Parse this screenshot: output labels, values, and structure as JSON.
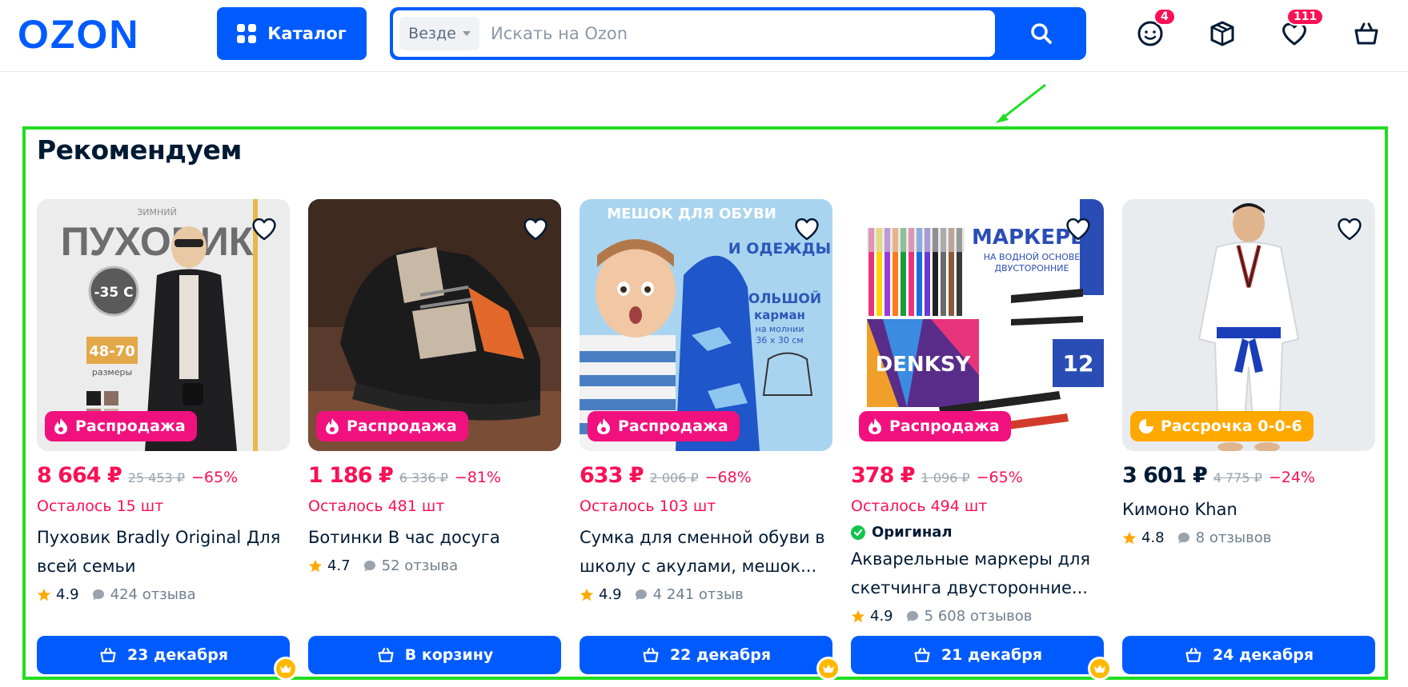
{
  "header": {
    "logo_text": "OZON",
    "catalog_label": "Каталог",
    "search": {
      "scope": "Везде",
      "placeholder": "Искать на Ozon"
    },
    "icons": [
      {
        "name": "profile-icon",
        "badge": "4"
      },
      {
        "name": "orders-icon",
        "badge": ""
      },
      {
        "name": "favorites-icon",
        "badge": "111"
      },
      {
        "name": "cart-icon",
        "badge": ""
      }
    ],
    "colors": {
      "brand": "#005bff",
      "accent": "#f91155"
    }
  },
  "section": {
    "title": "Рекомендуем",
    "products": [
      {
        "image": "winter-coat-photo",
        "badge": "Распродажа",
        "badge_icon": "fire-icon",
        "badge_color": "#f1117e",
        "price": "8 664 ₽",
        "old_price": "25 453 ₽",
        "discount": "−65%",
        "price_color": "#f91155",
        "stock": "Осталось 15 шт",
        "original": "",
        "name": "Пуховик Bradly Original Для всей семьи",
        "rating": "4.9",
        "reviews": "424 отзыва",
        "button": "23 декабря",
        "premium": true
      },
      {
        "image": "sneakers-photo",
        "badge": "Распродажа",
        "badge_icon": "fire-icon",
        "badge_color": "#f1117e",
        "price": "1 186 ₽",
        "old_price": "6 336 ₽",
        "discount": "−81%",
        "price_color": "#f91155",
        "stock": "Осталось 481 шт",
        "original": "",
        "name": "Ботинки В час досуга",
        "rating": "4.7",
        "reviews": "52 отзыва",
        "button": "В корзину",
        "premium": false
      },
      {
        "image": "shoe-bag-photo",
        "badge": "Распродажа",
        "badge_icon": "fire-icon",
        "badge_color": "#f1117e",
        "price": "633 ₽",
        "old_price": "2 006 ₽",
        "discount": "−68%",
        "price_color": "#f91155",
        "stock": "Осталось 103 шт",
        "original": "",
        "name": "Сумка для сменной обуви в школу с акулами, мешок...",
        "rating": "4.9",
        "reviews": "4 241 отзыв",
        "button": "22 декабря",
        "premium": true
      },
      {
        "image": "markers-photo",
        "badge": "Распродажа",
        "badge_icon": "fire-icon",
        "badge_color": "#f1117e",
        "price": "378 ₽",
        "old_price": "1 096 ₽",
        "discount": "−65%",
        "price_color": "#f91155",
        "stock": "Осталось 494 шт",
        "original": "Оригинал",
        "name": "Акварельные маркеры для скетчинга двусторонние...",
        "rating": "4.9",
        "reviews": "5 608 отзывов",
        "button": "21 декабря",
        "premium": true
      },
      {
        "image": "kimono-photo",
        "badge": "Рассрочка 0-0-6",
        "badge_icon": "installment-icon",
        "badge_color": "#ffa800",
        "price": "3 601 ₽",
        "old_price": "4 775 ₽",
        "discount": "−24%",
        "price_color": "#001a34",
        "stock": "",
        "original": "",
        "name": "Кимоно Khan",
        "rating": "4.8",
        "reviews": "8 отзывов",
        "button": "24 декабря",
        "premium": false
      }
    ]
  },
  "image_texts": {
    "coat": {
      "line1": "ЗИМНИЙ",
      "line2": "ПУХОВИК",
      "temp": "-35 С",
      "sizes": "48-70",
      "sizes_label": "размеры"
    },
    "bag": {
      "line1": "МЕШОК ДЛЯ ОБУВИ",
      "line2": "И ОДЕЖДЫ",
      "line3": "БОЛЬШОЙ",
      "line4": "карман",
      "line5": "на молнии",
      "line6": "36 х 30 см"
    },
    "markers": {
      "line1": "МАРКЕРЫ",
      "line2": "НА ВОДНОЙ ОСНОВЕ",
      "line3": "ДВУСТОРОННИЕ",
      "brand": "DENKSY",
      "count": "12"
    }
  }
}
